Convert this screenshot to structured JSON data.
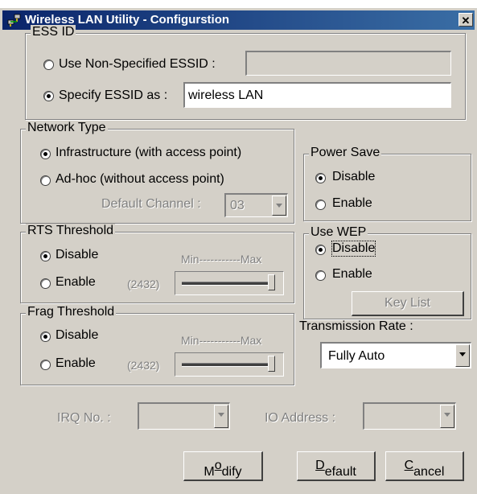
{
  "window": {
    "title": "Wireless LAN Utility - Configurstion",
    "close_glyph": "✕"
  },
  "essid": {
    "legend": "ESS ID",
    "opt_nonspecified": "Use Non-Specified ESSID :",
    "nonspecified_value": "",
    "opt_specify": "Specify ESSID as :",
    "specify_value": "wireless LAN",
    "selected": "specify"
  },
  "network_type": {
    "legend": "Network Type",
    "opt_infra": "Infrastructure (with access point)",
    "opt_adhoc": "Ad-hoc (without access point)",
    "channel_label": "Default Channel :",
    "channel_value": "03",
    "selected": "infrastructure"
  },
  "power_save": {
    "legend": "Power Save",
    "opt_disable": "Disable",
    "opt_enable": "Enable",
    "selected": "disable"
  },
  "rts": {
    "legend": "RTS Threshold",
    "opt_disable": "Disable",
    "opt_enable": "Enable",
    "value": "(2432)",
    "range_min": "Min",
    "range_dashes": "-----------",
    "range_max": "Max",
    "selected": "disable"
  },
  "wep": {
    "legend": "Use WEP",
    "opt_disable": "Disable",
    "opt_enable": "Enable",
    "keylist_button": "Key List",
    "selected": "disable"
  },
  "frag": {
    "legend": "Frag Threshold",
    "opt_disable": "Disable",
    "opt_enable": "Enable",
    "value": "(2432)",
    "range_min": "Min",
    "range_dashes": "-----------",
    "range_max": "Max",
    "selected": "disable"
  },
  "transmission": {
    "label": "Transmission Rate :",
    "value": "Fully Auto"
  },
  "irq": {
    "label": "IRQ No. :",
    "value": ""
  },
  "io": {
    "label": "IO Address :",
    "value": ""
  },
  "buttons": {
    "modify_pre": "M",
    "modify_key": "o",
    "modify_post": "dify",
    "default_key": "D",
    "default_post": "efault",
    "cancel_key": "C",
    "cancel_post": "ancel"
  }
}
